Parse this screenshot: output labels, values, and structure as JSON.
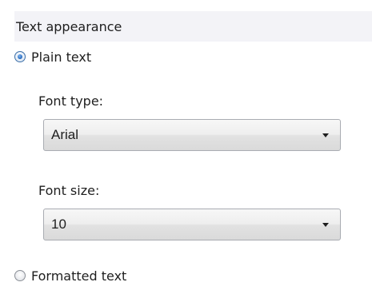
{
  "section": {
    "title": "Text appearance"
  },
  "options": {
    "plain_text": {
      "label": "Plain text",
      "selected": true
    },
    "formatted_text": {
      "label": "Formatted text",
      "selected": false
    }
  },
  "font_type": {
    "label": "Font type:",
    "value": "Arial"
  },
  "font_size": {
    "label": "Font size:",
    "value": "10"
  }
}
